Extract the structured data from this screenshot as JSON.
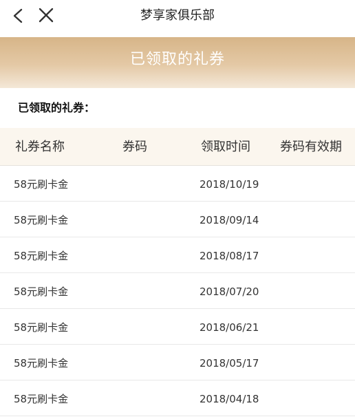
{
  "nav": {
    "title": "梦享家俱乐部",
    "back_icon": "chevron-left-icon",
    "close_icon": "close-icon"
  },
  "banner": {
    "title": "已领取的礼券",
    "gradient_colors": [
      "#d7b588",
      "#f4e8d8"
    ]
  },
  "section": {
    "label": "已领取的礼券："
  },
  "table": {
    "headers": {
      "name": "礼券名称",
      "code": "券码",
      "date": "领取时间",
      "expire": "券码有效期"
    },
    "rows": [
      {
        "name": "58元刷卡金",
        "code": "",
        "date": "2018/10/19",
        "expire": ""
      },
      {
        "name": "58元刷卡金",
        "code": "",
        "date": "2018/09/14",
        "expire": ""
      },
      {
        "name": "58元刷卡金",
        "code": "",
        "date": "2018/08/17",
        "expire": ""
      },
      {
        "name": "58元刷卡金",
        "code": "",
        "date": "2018/07/20",
        "expire": ""
      },
      {
        "name": "58元刷卡金",
        "code": "",
        "date": "2018/06/21",
        "expire": ""
      },
      {
        "name": "58元刷卡金",
        "code": "",
        "date": "2018/05/17",
        "expire": ""
      },
      {
        "name": "58元刷卡金",
        "code": "",
        "date": "2018/04/18",
        "expire": ""
      }
    ]
  }
}
